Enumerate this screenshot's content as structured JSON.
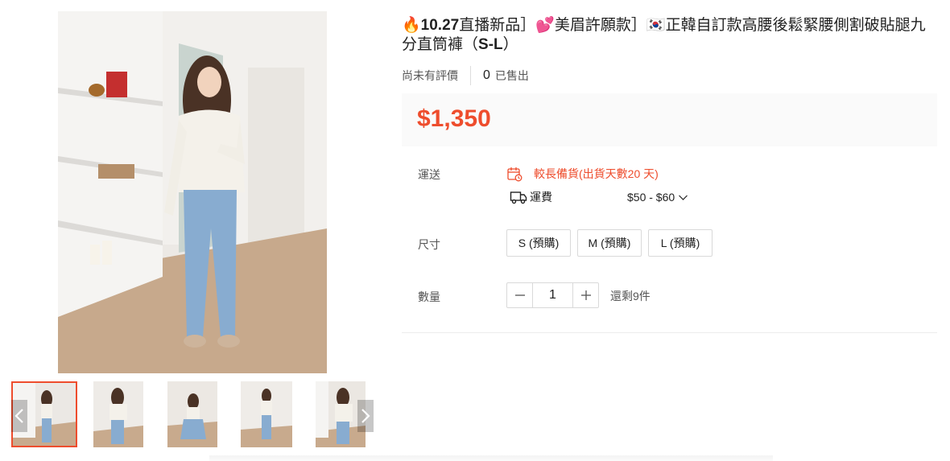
{
  "product": {
    "title_prefix": "🔥",
    "title_tag1": "10.27",
    "title_tag1_rest": "直播新品］",
    "title_heart": "💕",
    "title_tag2": "美眉許願款］",
    "title_flag": "🇰🇷",
    "title_main": "正韓自訂款高腰後鬆緊腰側割破貼腿九分直筒褲（",
    "title_size_range": "S-L",
    "title_end": "）",
    "rating_text": "尚未有評價",
    "sold_count": "0",
    "sold_label": "已售出",
    "price": "$1,350"
  },
  "shipping": {
    "label": "運送",
    "warning": "較長備貨(出貨天數20 天)",
    "fee_label": "運費",
    "fee_range": "$50 - $60"
  },
  "size": {
    "label": "尺寸",
    "options": [
      "S (預購)",
      "M (預購)",
      "L (預購)"
    ]
  },
  "quantity": {
    "label": "數量",
    "value": "1",
    "stock_text": "還剩9件"
  },
  "gallery": {
    "thumbnail_count": 5,
    "active_index": 0
  },
  "colors": {
    "accent": "#ee4d2d",
    "price_bg": "#fafafa"
  },
  "icons": {
    "prev": "chevron-left-icon",
    "next": "chevron-right-icon",
    "calendar": "calendar-clock-icon",
    "truck": "truck-icon",
    "dropdown": "chevron-down-icon",
    "minus": "minus-icon",
    "plus": "plus-icon"
  }
}
